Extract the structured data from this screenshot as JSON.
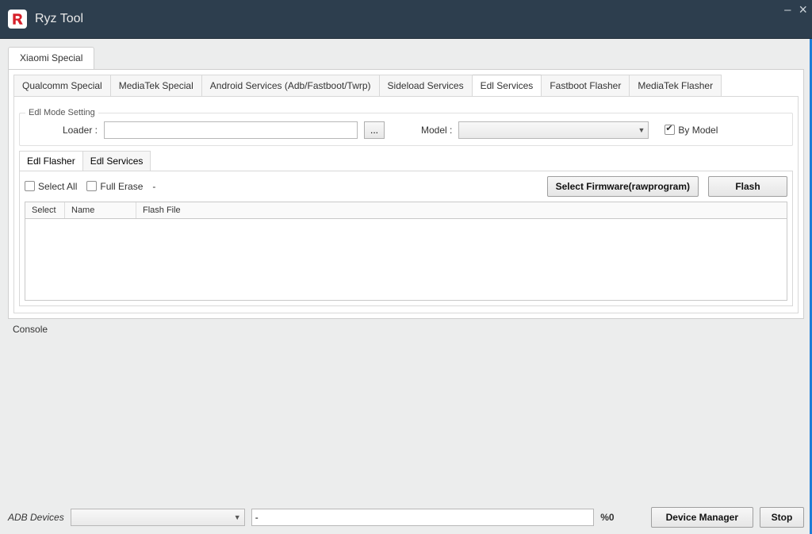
{
  "app": {
    "title": "Ryz Tool"
  },
  "win_controls": {
    "minimize": "–",
    "close": "×"
  },
  "tabs1": {
    "items": [
      {
        "label": "Xiaomi Special"
      }
    ],
    "active": 0
  },
  "tabs2": {
    "items": [
      {
        "label": "Qualcomm Special"
      },
      {
        "label": "MediaTek Special"
      },
      {
        "label": "Android Services (Adb/Fastboot/Twrp)"
      },
      {
        "label": "Sideload Services"
      },
      {
        "label": "Edl Services"
      },
      {
        "label": "Fastboot Flasher"
      },
      {
        "label": "MediaTek Flasher"
      }
    ],
    "active": 4
  },
  "edl_mode": {
    "frame_title": "Edl Mode Setting",
    "loader_label": "Loader :",
    "loader_value": "",
    "browse_label": "...",
    "model_label": "Model :",
    "model_value": "",
    "by_model_label": "By Model",
    "by_model_checked": true
  },
  "tabs3": {
    "items": [
      {
        "label": "Edl Flasher"
      },
      {
        "label": "Edl Services"
      }
    ],
    "active": 0
  },
  "flasher": {
    "select_all_label": "Select All",
    "full_erase_label": "Full Erase",
    "dash": "-",
    "select_firmware_label": "Select Firmware(rawprogram)",
    "flash_label": "Flash",
    "cols": {
      "select": "Select",
      "name": "Name",
      "flash_file": "Flash File"
    }
  },
  "console": {
    "label": "Console"
  },
  "bottom": {
    "adb_label": "ADB Devices",
    "adb_value": "",
    "status_value": "-",
    "progress_label": "%0",
    "device_manager_label": "Device Manager",
    "stop_label": "Stop"
  }
}
